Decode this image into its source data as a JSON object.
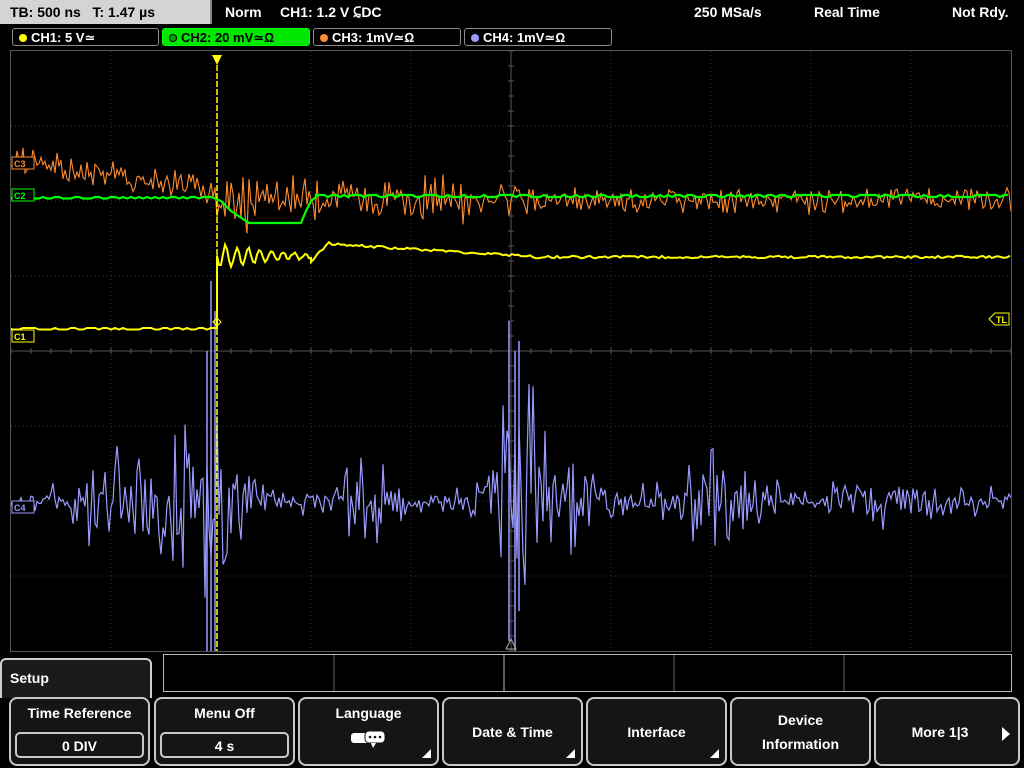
{
  "topbar": {
    "timebase": "TB: 500 ns",
    "trigger_time": "T: 1.47 µs",
    "mode": "Norm",
    "trigger_setting": "CH1: 1.2 V ⫇DC",
    "sample_rate": "250 MSa/s",
    "acq_mode": "Real Time",
    "status": "Not Rdy."
  },
  "channels": [
    {
      "label": "CH1: 5 V≃",
      "color": "#ffff00"
    },
    {
      "label": "CH2: 20 mV≃Ω",
      "color": "#00ff00"
    },
    {
      "label": "CH3: 1mV≃Ω",
      "color": "#ff8c2e"
    },
    {
      "label": "CH4: 1mV≃Ω",
      "color": "#9a9aff"
    }
  ],
  "markers": {
    "ch3": "C3",
    "ch2": "C2",
    "ch1": "C1",
    "ch4": "C4",
    "trigger_level": "TL"
  },
  "menu": {
    "title": "Setup",
    "buttons": [
      {
        "label": "Time Reference",
        "value": "0 DIV"
      },
      {
        "label": "Menu Off",
        "value": "4 s"
      },
      {
        "label": "Language"
      },
      {
        "label": "Date & Time"
      },
      {
        "label": "Interface"
      },
      {
        "label": "Device",
        "label2": "Information"
      },
      {
        "label": "More 1|3"
      }
    ]
  },
  "colors": {
    "ch1": "#ffff00",
    "ch2": "#00ff00",
    "ch3": "#ff8c2e",
    "ch4": "#9a9aff",
    "grid": "#3a3a3a"
  }
}
